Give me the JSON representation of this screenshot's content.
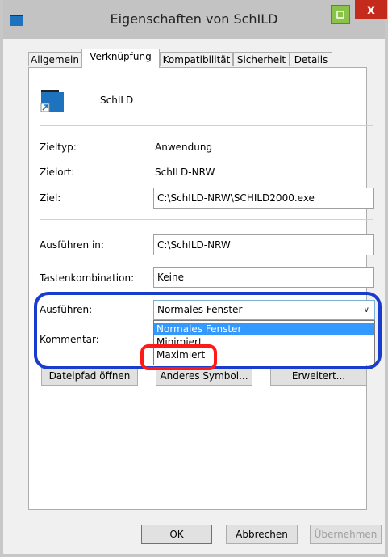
{
  "window": {
    "title": "Eigenschaften von SchILD",
    "close_label": "x"
  },
  "tabs": [
    "Allgemein",
    "Verknüpfung",
    "Kompatibilität",
    "Sicherheit",
    "Details"
  ],
  "app": {
    "name": "SchILD"
  },
  "fields": {
    "zieltyp_label": "Zieltyp:",
    "zieltyp_value": "Anwendung",
    "zielort_label": "Zielort:",
    "zielort_value": "SchILD-NRW",
    "ziel_label": "Ziel:",
    "ziel_value": "C:\\SchILD-NRW\\SCHILD2000.exe",
    "ausfuehren_in_label": "Ausführen in:",
    "ausfuehren_in_value": "C:\\SchILD-NRW",
    "tasten_label": "Tastenkombination:",
    "tasten_value": "Keine",
    "ausfuehren_label": "Ausführen:",
    "ausfuehren_value": "Normales Fenster",
    "kommentar_label": "Kommentar:"
  },
  "dropdown_options": [
    "Normales Fenster",
    "Minimiert",
    "Maximiert"
  ],
  "buttons": {
    "dateipfad": "Dateipfad öffnen",
    "symbol": "Anderes Symbol...",
    "erweitert": "Erweitert...",
    "ok": "OK",
    "abbrechen": "Abbrechen",
    "uebernehmen": "Übernehmen"
  },
  "colors": {
    "selection": "#3399ff",
    "highlight_blue": "#1a3ccc",
    "highlight_red": "#ff1a1a",
    "close": "#c42b1c"
  }
}
